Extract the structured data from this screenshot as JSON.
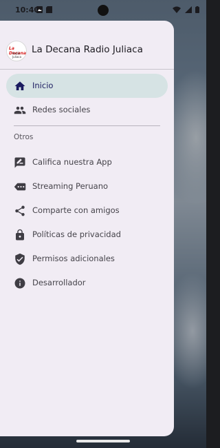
{
  "status_bar": {
    "time": "10:40"
  },
  "drawer": {
    "app_title": "La Decana Radio Juliaca",
    "logo_text": "La Decana",
    "logo_subtext": "Radio Juliaca",
    "primary_items": [
      {
        "label": "Inicio",
        "icon": "home-icon"
      },
      {
        "label": "Redes sociales",
        "icon": "people-icon"
      }
    ],
    "section_title": "Otros",
    "other_items": [
      {
        "label": "Califica nuestra App",
        "icon": "rate-review-icon"
      },
      {
        "label": "Streaming Peruano",
        "icon": "label-tag-icon"
      },
      {
        "label": "Comparte con amigos",
        "icon": "share-icon"
      },
      {
        "label": "Políticas de privacidad",
        "icon": "lock-icon"
      },
      {
        "label": "Permisos adicionales",
        "icon": "verified-shield-icon"
      },
      {
        "label": "Desarrollador",
        "icon": "info-icon"
      }
    ]
  },
  "colors": {
    "drawer_bg": "#f1ecf4",
    "active_item_bg": "#d6e3e4",
    "active_text": "#1b1b60",
    "icon": "#3f3d44"
  }
}
